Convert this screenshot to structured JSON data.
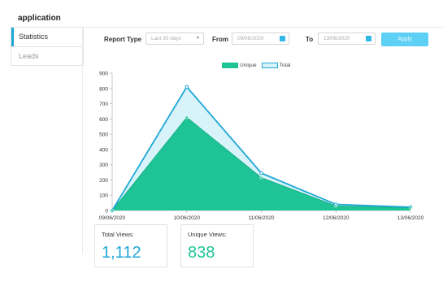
{
  "app": {
    "title": "application"
  },
  "sidebar": {
    "items": [
      {
        "label": "Statistics",
        "active": true
      },
      {
        "label": "Leads",
        "active": false
      }
    ]
  },
  "filters": {
    "report_type_label": "Report Type",
    "report_type_value": "Last 30 days",
    "from_label": "From",
    "from_value": "09/06/2020",
    "to_label": "To",
    "to_value": "13/06/2020",
    "apply_label": "Apply"
  },
  "colors": {
    "accent": "#1fa8d6",
    "unique_fill": "#1fc496",
    "total_fill": "#d8f3f9",
    "apply_button": "#5ed0f5"
  },
  "chart_data": {
    "type": "area",
    "x": [
      "09/06/2020",
      "10/06/2020",
      "11/06/2020",
      "12/06/2020",
      "13/06/2020"
    ],
    "series": [
      {
        "name": "Unique",
        "values": [
          0,
          610,
          215,
          30,
          18
        ]
      },
      {
        "name": "Total",
        "values": [
          0,
          810,
          245,
          40,
          22
        ]
      }
    ],
    "y_ticks": [
      0,
      100,
      200,
      300,
      400,
      500,
      600,
      700,
      800,
      900
    ],
    "ylim": [
      0,
      900
    ],
    "legend": [
      "Unique",
      "Total"
    ],
    "legend_position": "top-center",
    "grid": false
  },
  "stats": {
    "total_views_label": "Total Views:",
    "total_views_value": "1,112",
    "unique_views_label": "Unique Views:",
    "unique_views_value": "838"
  }
}
